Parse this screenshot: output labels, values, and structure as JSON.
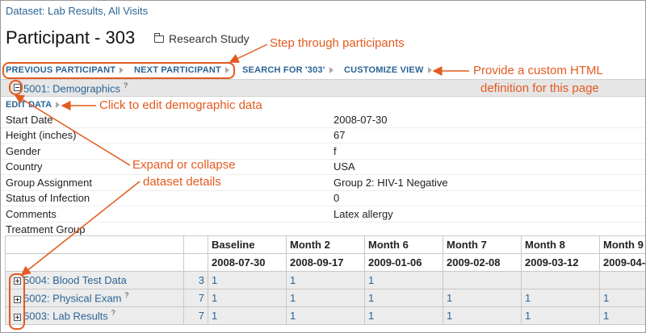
{
  "breadcrumb": "Dataset: Lab Results, All Visits",
  "page_title": "Participant - 303",
  "study_label": "Research Study",
  "nav": {
    "previous": "PREVIOUS PARTICIPANT",
    "next": "NEXT PARTICIPANT",
    "search": "SEARCH FOR '303'",
    "customize": "CUSTOMIZE VIEW"
  },
  "section": {
    "title": "5001: Demographics",
    "help_mark": "?",
    "edit_label": "EDIT DATA"
  },
  "fields": [
    {
      "label": "Start Date",
      "value": "2008-07-30"
    },
    {
      "label": "Height (inches)",
      "value": "67"
    },
    {
      "label": "Gender",
      "value": "f"
    },
    {
      "label": "Country",
      "value": "USA"
    },
    {
      "label": "Group Assignment",
      "value": "Group 2: HIV-1 Negative"
    },
    {
      "label": "Status of Infection",
      "value": "0"
    },
    {
      "label": "Comments",
      "value": "Latex allergy"
    },
    {
      "label": "Treatment Group",
      "value": ""
    }
  ],
  "grid": {
    "visits": [
      "Baseline",
      "Month 2",
      "Month 6",
      "Month 7",
      "Month 8",
      "Month 9"
    ],
    "dates": [
      "2008-07-30",
      "2008-09-17",
      "2009-01-06",
      "2009-02-08",
      "2009-03-12",
      "2009-04-"
    ],
    "datasets": [
      {
        "name": "5004: Blood Test Data",
        "help": "",
        "count": "3",
        "values": [
          "1",
          "1",
          "1",
          "",
          "",
          ""
        ]
      },
      {
        "name": "5002: Physical Exam",
        "help": "?",
        "count": "7",
        "values": [
          "1",
          "1",
          "1",
          "1",
          "1",
          "1"
        ]
      },
      {
        "name": "5003: Lab Results",
        "help": "?",
        "count": "7",
        "values": [
          "1",
          "1",
          "1",
          "1",
          "1",
          "1"
        ]
      }
    ]
  },
  "annotations": {
    "step": "Step through participants",
    "custom_line1": "Provide a custom HTML",
    "custom_line2": "definition for this page",
    "edit": "Click to edit demographic data",
    "expand_line1": "Expand or collapse",
    "expand_line2": "dataset details"
  },
  "colors": {
    "link": "#2a6496",
    "annotation": "#e35a1f",
    "section_bg": "#e6e6e6"
  }
}
